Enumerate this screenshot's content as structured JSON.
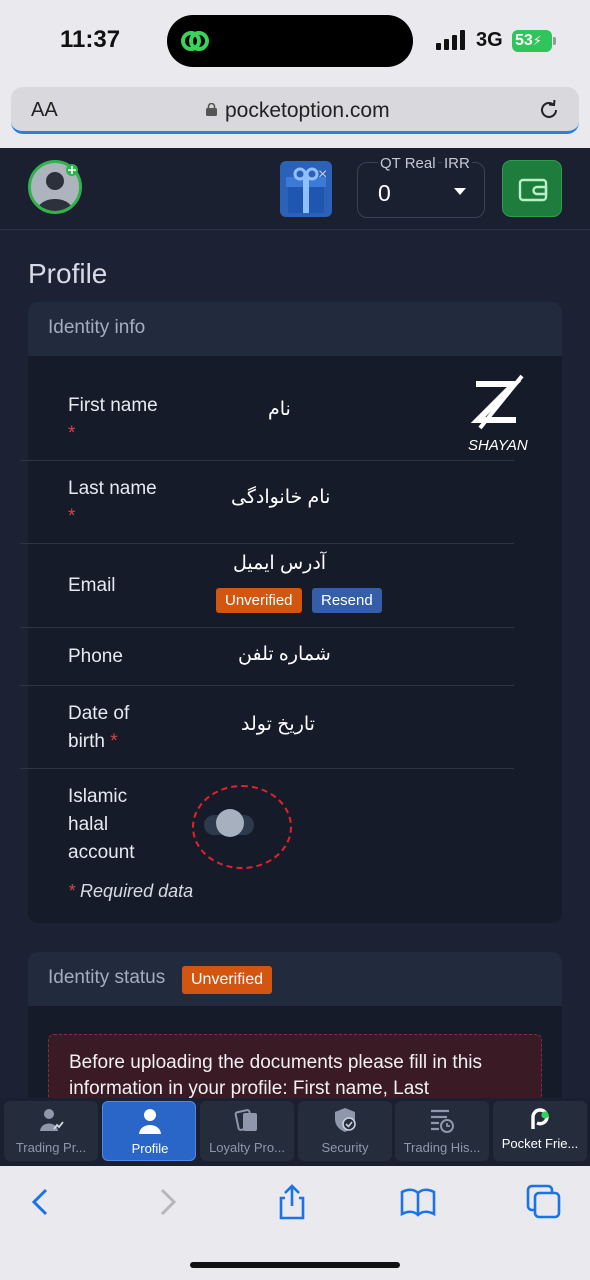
{
  "status_bar": {
    "time": "11:37",
    "network": "3G",
    "battery": "53"
  },
  "browser": {
    "text_size": "AA",
    "url": "pocketoption.com"
  },
  "header": {
    "account_type": "QT Real",
    "currency": "IRR",
    "balance": "0",
    "gift_close": "×"
  },
  "page": {
    "title": "Profile"
  },
  "identity_info": {
    "title": "Identity info",
    "fields": [
      {
        "label": "First name",
        "required": "*",
        "value": "نام"
      },
      {
        "label": "Last name",
        "required": "*",
        "value": "نام خانوادگی"
      },
      {
        "label": "Email",
        "value": "آدرس ایمیل",
        "status": "Unverified",
        "action": "Resend"
      },
      {
        "label": "Phone",
        "value": "شماره تلفن"
      },
      {
        "label_line1": "Date of",
        "label_line2": "birth",
        "required": "*",
        "value": "تاریخ تولد"
      },
      {
        "label_line1": "Islamic",
        "label_line2": "halal",
        "label_line3": "account",
        "toggle_on": false
      }
    ],
    "required_note_star": "*",
    "required_note": "Required data"
  },
  "identity_status": {
    "title": "Identity status",
    "badge": "Unverified",
    "notice": "Before uploading the documents please fill in this information in your profile: First name, Last"
  },
  "bottom_nav": [
    {
      "label": "Trading Pr...",
      "icon": "trading-profile-icon",
      "active": false
    },
    {
      "label": "Profile",
      "icon": "profile-icon",
      "active": true
    },
    {
      "label": "Loyalty Pro...",
      "icon": "loyalty-icon",
      "active": false
    },
    {
      "label": "Security",
      "icon": "shield-icon",
      "active": false
    },
    {
      "label": "Trading His...",
      "icon": "history-icon",
      "active": false
    },
    {
      "label": "Pocket Frie...",
      "icon": "pocket-friends-icon",
      "active": false
    }
  ],
  "colors": {
    "accent_green": "#2fb34a",
    "badge_orange": "#d2560f",
    "badge_blue": "#345ea8",
    "active_tab": "#2a66c8",
    "annotation_red": "#e2222b"
  }
}
